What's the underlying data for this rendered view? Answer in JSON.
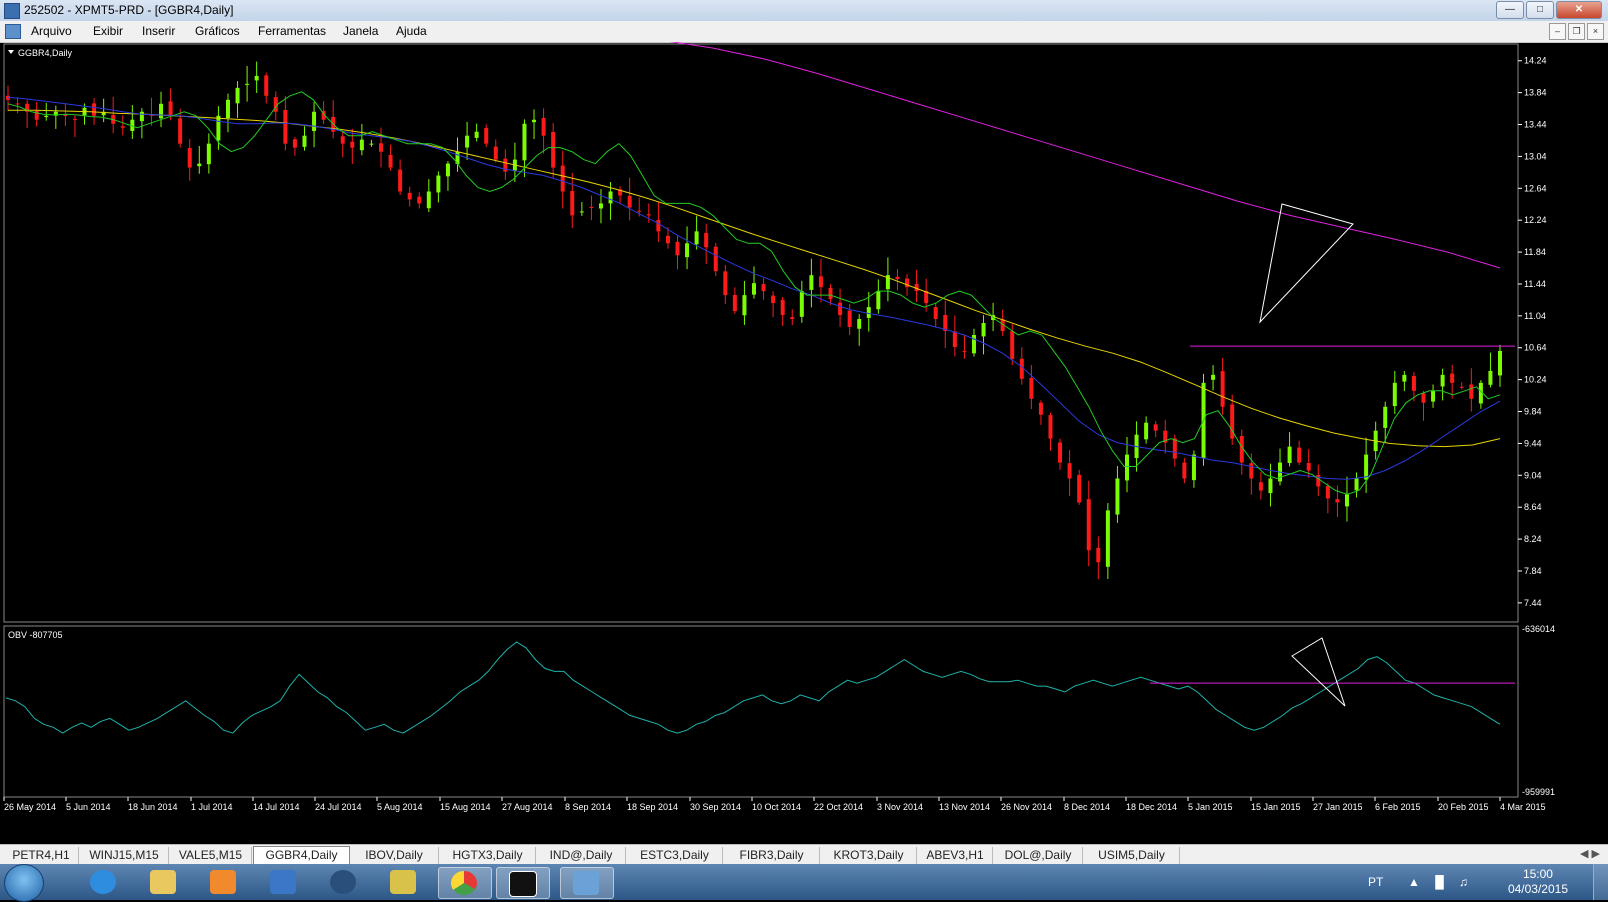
{
  "window": {
    "title": "252502 - XPMT5-PRD - [GGBR4,Daily]"
  },
  "menu": {
    "items": [
      "Arquivo",
      "Exibir",
      "Inserir",
      "Gráficos",
      "Ferramentas",
      "Janela",
      "Ajuda"
    ]
  },
  "chart_data": [
    {
      "type": "candlestick",
      "title": "GGBR4,Daily",
      "y_ticks": [
        "14.24",
        "13.84",
        "13.44",
        "13.04",
        "12.64",
        "12.24",
        "11.84",
        "11.44",
        "11.04",
        "10.64",
        "10.24",
        "9.84",
        "9.44",
        "9.04",
        "8.64",
        "8.24",
        "7.84",
        "7.44"
      ],
      "ylim": [
        7.2,
        14.45
      ],
      "x_ticks": [
        "26 May 2014",
        "5 Jun 2014",
        "18 Jun 2014",
        "1 Jul 2014",
        "14 Jul 2014",
        "24 Jul 2014",
        "5 Aug 2014",
        "15 Aug 2014",
        "27 Aug 2014",
        "8 Sep 2014",
        "18 Sep 2014",
        "30 Sep 2014",
        "10 Oct 2014",
        "22 Oct 2014",
        "3 Nov 2014",
        "13 Nov 2014",
        "26 Nov 2014",
        "8 Dec 2014",
        "18 Dec 2014",
        "5 Jan 2015",
        "15 Jan 2015",
        "27 Jan 2015",
        "6 Feb 2015",
        "20 Feb 2015",
        "4 Mar 2015"
      ],
      "close_path": [
        13.75,
        13.7,
        13.6,
        13.5,
        13.55,
        13.6,
        13.55,
        13.5,
        13.65,
        13.55,
        13.6,
        13.45,
        13.4,
        13.5,
        13.6,
        13.55,
        13.7,
        13.55,
        13.2,
        12.9,
        12.95,
        13.2,
        13.55,
        13.75,
        13.9,
        13.95,
        14.05,
        13.8,
        13.6,
        13.2,
        13.15,
        13.3,
        13.6,
        13.5,
        13.35,
        13.2,
        13.15,
        13.25,
        13.2,
        13.1,
        12.9,
        12.6,
        12.5,
        12.45,
        12.6,
        12.8,
        12.95,
        13.1,
        13.3,
        13.35,
        13.2,
        13.0,
        12.85,
        13.0,
        13.45,
        13.5,
        13.3,
        12.9,
        12.6,
        12.3,
        12.35,
        12.4,
        12.45,
        12.6,
        12.55,
        12.4,
        12.35,
        12.3,
        12.1,
        11.95,
        11.8,
        11.95,
        12.1,
        11.9,
        11.6,
        11.3,
        11.1,
        11.3,
        11.45,
        11.35,
        11.2,
        11.05,
        11.0,
        11.35,
        11.55,
        11.4,
        11.25,
        11.05,
        10.9,
        11.0,
        11.15,
        11.35,
        11.55,
        11.5,
        11.4,
        11.35,
        11.2,
        11.0,
        10.85,
        10.65,
        10.6,
        10.8,
        10.95,
        11.05,
        10.85,
        10.5,
        10.25,
        10.0,
        9.8,
        9.5,
        9.2,
        9.0,
        8.7,
        8.1,
        7.95,
        8.6,
        9.0,
        9.3,
        9.55,
        9.7,
        9.6,
        9.45,
        9.25,
        9.0,
        9.3,
        10.2,
        10.3,
        9.9,
        9.5,
        9.2,
        9.0,
        8.85,
        9.0,
        9.2,
        9.4,
        9.2,
        9.1,
        8.9,
        8.75,
        8.7,
        8.8,
        9.0,
        9.3,
        9.6,
        9.9,
        10.2,
        10.3,
        10.1,
        9.95,
        10.1,
        10.3,
        10.2,
        10.15,
        10.0,
        10.2,
        10.35,
        10.6
      ],
      "ma_green": [
        13.7,
        13.66,
        13.6,
        13.57,
        13.56,
        13.57,
        13.56,
        13.54,
        13.53,
        13.5,
        13.45,
        13.4,
        13.45,
        13.5,
        13.55,
        13.6,
        13.55,
        13.4,
        13.2,
        13.1,
        13.15,
        13.3,
        13.5,
        13.7,
        13.8,
        13.85,
        13.75,
        13.55,
        13.4,
        13.3,
        13.3,
        13.35,
        13.3,
        13.25,
        13.2,
        13.2,
        13.2,
        13.15,
        13.0,
        12.8,
        12.65,
        12.6,
        12.65,
        12.75,
        12.9,
        13.05,
        13.15,
        13.15,
        13.1,
        13.0,
        12.95,
        13.1,
        13.2,
        13.05,
        12.8,
        12.55,
        12.45,
        12.45,
        12.45,
        12.4,
        12.3,
        12.15,
        12.0,
        11.95,
        11.95,
        11.85,
        11.6,
        11.4,
        11.3,
        11.3,
        11.3,
        11.25,
        11.2,
        11.25,
        11.35,
        11.35,
        11.3,
        11.2,
        11.15,
        11.2,
        11.3,
        11.35,
        11.3,
        11.15,
        11.0,
        10.9,
        10.8,
        10.85,
        10.8,
        10.6,
        10.4,
        10.15,
        9.9,
        9.6,
        9.35,
        9.15,
        9.15,
        9.3,
        9.45,
        9.5,
        9.45,
        9.5,
        9.8,
        9.85,
        9.65,
        9.4,
        9.2,
        9.05,
        9.0,
        9.05,
        9.1,
        9.05,
        8.95,
        8.85,
        8.8,
        8.85,
        9.05,
        9.4,
        9.75,
        9.95,
        10.05,
        10.1,
        10.1,
        10.05,
        10.1,
        10.15,
        10.0,
        10.05
      ],
      "ma_blue": [
        13.78,
        13.76,
        13.73,
        13.7,
        13.67,
        13.64,
        13.6,
        13.57,
        13.56,
        13.55,
        13.52,
        13.48,
        13.45,
        13.45,
        13.46,
        13.45,
        13.42,
        13.38,
        13.33,
        13.3,
        13.27,
        13.23,
        13.17,
        13.1,
        13.02,
        12.94,
        12.88,
        12.84,
        12.8,
        12.73,
        12.65,
        12.55,
        12.45,
        12.32,
        12.2,
        12.05,
        11.92,
        11.8,
        11.68,
        11.57,
        11.48,
        11.38,
        11.3,
        11.2,
        11.12,
        11.07,
        11.03,
        10.98,
        10.93,
        10.87,
        10.8,
        10.7,
        10.57,
        10.4,
        10.18,
        9.95,
        9.72,
        9.55,
        9.45,
        9.4,
        9.36,
        9.33,
        9.28,
        9.23,
        9.2,
        9.15,
        9.1,
        9.06,
        9.03,
        9.0,
        8.99,
        9.02,
        9.1,
        9.22,
        9.36,
        9.52,
        9.68,
        9.84,
        9.97
      ],
      "ma_yellow": [
        13.62,
        13.62,
        13.61,
        13.6,
        13.58,
        13.57,
        13.55,
        13.53,
        13.51,
        13.49,
        13.46,
        13.42,
        13.38,
        13.33,
        13.27,
        13.2,
        13.12,
        13.04,
        12.96,
        12.88,
        12.8,
        12.72,
        12.63,
        12.53,
        12.42,
        12.3,
        12.18,
        12.06,
        11.95,
        11.84,
        11.73,
        11.62,
        11.5,
        11.37,
        11.24,
        11.11,
        10.99,
        10.87,
        10.76,
        10.66,
        10.57,
        10.46,
        10.32,
        10.17,
        10.02,
        9.88,
        9.76,
        9.66,
        9.57,
        9.5,
        9.44,
        9.41,
        9.4,
        9.42,
        9.5
      ],
      "ma_magenta": [
        14.5,
        14.4,
        14.26,
        14.08,
        13.88,
        13.68,
        13.48,
        13.28,
        13.08,
        12.88,
        12.68,
        12.48,
        12.3,
        12.15,
        12.0,
        11.84,
        11.64
      ],
      "annotations": {
        "resistance_level": 10.66
      }
    },
    {
      "type": "line",
      "title": "OBV -807705",
      "y_ticks": [
        "-636014",
        "-959991"
      ],
      "values": [
        0.62,
        0.6,
        0.56,
        0.48,
        0.44,
        0.42,
        0.38,
        0.42,
        0.45,
        0.42,
        0.46,
        0.48,
        0.44,
        0.4,
        0.42,
        0.45,
        0.48,
        0.52,
        0.56,
        0.6,
        0.55,
        0.5,
        0.46,
        0.4,
        0.38,
        0.45,
        0.5,
        0.53,
        0.56,
        0.6,
        0.7,
        0.78,
        0.72,
        0.66,
        0.62,
        0.56,
        0.52,
        0.46,
        0.4,
        0.42,
        0.44,
        0.4,
        0.38,
        0.42,
        0.46,
        0.5,
        0.55,
        0.6,
        0.66,
        0.7,
        0.74,
        0.8,
        0.88,
        0.95,
        1.0,
        0.96,
        0.88,
        0.82,
        0.8,
        0.8,
        0.74,
        0.7,
        0.66,
        0.62,
        0.58,
        0.54,
        0.5,
        0.48,
        0.46,
        0.44,
        0.4,
        0.38,
        0.4,
        0.44,
        0.46,
        0.5,
        0.52,
        0.56,
        0.6,
        0.62,
        0.64,
        0.6,
        0.58,
        0.6,
        0.64,
        0.62,
        0.6,
        0.66,
        0.7,
        0.74,
        0.72,
        0.74,
        0.76,
        0.8,
        0.84,
        0.88,
        0.84,
        0.8,
        0.78,
        0.76,
        0.78,
        0.8,
        0.78,
        0.75,
        0.73,
        0.73,
        0.73,
        0.74,
        0.72,
        0.7,
        0.7,
        0.68,
        0.66,
        0.7,
        0.72,
        0.74,
        0.72,
        0.7,
        0.72,
        0.74,
        0.76,
        0.74,
        0.72,
        0.7,
        0.68,
        0.7,
        0.66,
        0.6,
        0.54,
        0.5,
        0.46,
        0.42,
        0.4,
        0.42,
        0.46,
        0.5,
        0.55,
        0.58,
        0.62,
        0.66,
        0.7,
        0.74,
        0.78,
        0.82,
        0.88,
        0.9,
        0.86,
        0.8,
        0.74,
        0.72,
        0.68,
        0.64,
        0.62,
        0.6,
        0.58,
        0.56,
        0.52,
        0.48,
        0.44
      ],
      "annotations": {
        "resistance_level": "max"
      }
    }
  ],
  "tabs": [
    "PETR4,H1",
    "WINJ15,M15",
    "VALE5,M15",
    "GGBR4,Daily",
    "IBOV,Daily",
    "HGTX3,Daily",
    "IND@,Daily",
    "ESTC3,Daily",
    "FIBR3,Daily",
    "KROT3,Daily",
    "ABEV3,H1",
    "DOL@,Daily",
    "USIM5,Daily"
  ],
  "active_tab": "GGBR4,Daily",
  "tray": {
    "language": "PT",
    "time": "15:00",
    "date": "04/03/2015"
  },
  "colors": {
    "up": "#7CFC00",
    "down": "#FF1A1A",
    "ma_green": "#22cc22",
    "ma_blue": "#2a3ae0",
    "ma_yellow": "#e8d400",
    "ma_magenta": "#e020e0",
    "obv": "#20b2aa"
  }
}
